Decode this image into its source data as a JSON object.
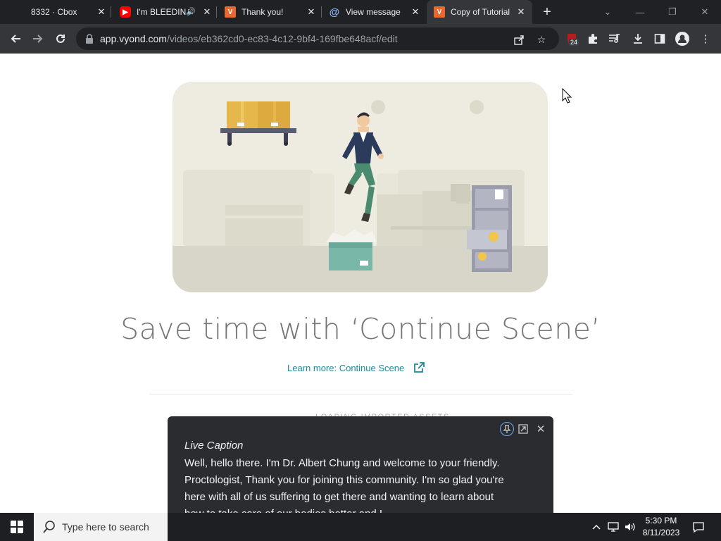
{
  "browser": {
    "tabs": [
      {
        "title": "8332 · Cbox",
        "favicon": "cbox-icon"
      },
      {
        "title": "I'm BLEEDIN",
        "favicon": "youtube-icon"
      },
      {
        "title": "Thank you!",
        "favicon": "vyond-icon"
      },
      {
        "title": "View message -",
        "favicon": "at-icon"
      },
      {
        "title": "Copy of Tutorial",
        "favicon": "vyond-icon"
      }
    ],
    "active_tab": 4,
    "url_host": "app.vyond.com",
    "url_path": "/videos/eb362cd0-ec83-4c12-9bf4-169fbe648acf/edit",
    "extension_badge": "24"
  },
  "page": {
    "headline": "Save time with ‘Continue Scene’",
    "learn_more": "Learn more: Continue Scene",
    "loading_text": "LOADING IMPORTED ASSETS"
  },
  "live_caption": {
    "title": "Live Caption",
    "lines": [
      "Well, hello there. I'm Dr. Albert Chung and welcome to your friendly.",
      "Proctologist, Thank you for joining this community. I'm so glad you're",
      "here with all of us suffering to get there and wanting to learn about",
      "how to take care of our bodies better and I"
    ]
  },
  "taskbar": {
    "search_placeholder": "Type here to search",
    "time": "5:30 PM",
    "date": "8/11/2023"
  },
  "colors": {
    "accent": "#1c8a9a",
    "caption_bg": "#2b2c2f",
    "chrome_dark": "#202124",
    "illustration_bg": "#eeece0"
  }
}
